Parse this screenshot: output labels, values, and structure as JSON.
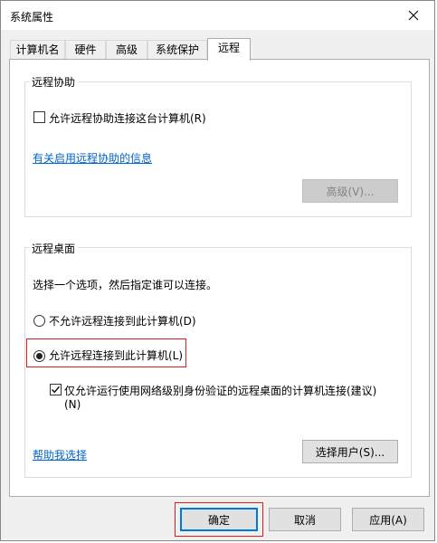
{
  "window": {
    "title": "系统属性"
  },
  "tabs": [
    {
      "label": "计算机名",
      "active": false
    },
    {
      "label": "硬件",
      "active": false
    },
    {
      "label": "高级",
      "active": false
    },
    {
      "label": "系统保护",
      "active": false
    },
    {
      "label": "远程",
      "active": true
    }
  ],
  "remote_assistance": {
    "legend": "远程协助",
    "allow_label": "允许远程协助连接这台计算机(R)",
    "allow_checked": false,
    "info_link": "有关启用远程协助的信息",
    "advanced_button": "高级(V)..."
  },
  "remote_desktop": {
    "legend": "远程桌面",
    "instruction": "选择一个选项，然后指定谁可以连接。",
    "option_deny": "不允许远程连接到此计算机(D)",
    "option_allow": "允许远程连接到此计算机(L)",
    "selected_option": "allow",
    "nla_label_line1": "仅允许运行使用网络级别身份验证的远程桌面的计算机连接(建议)",
    "nla_label_line2": "(N)",
    "nla_checked": true,
    "help_link": "帮助我选择",
    "select_users_button": "选择用户(S)..."
  },
  "footer": {
    "ok": "确定",
    "cancel": "取消",
    "apply": "应用(A)"
  },
  "colors": {
    "link": "#0066cc",
    "highlight_box": "#e01b1b",
    "default_button_border": "#0078d7"
  }
}
